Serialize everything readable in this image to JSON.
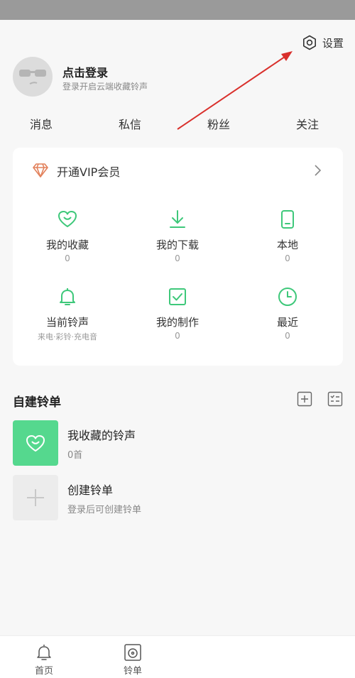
{
  "header": {
    "settings_label": "设置",
    "login_title": "点击登录",
    "login_subtitle": "登录开启云端收藏铃声"
  },
  "social": {
    "items": [
      "消息",
      "私信",
      "粉丝",
      "关注"
    ]
  },
  "vip": {
    "label": "开通VIP会员"
  },
  "grid": [
    {
      "label": "我的收藏",
      "count": "0",
      "icon": "heart-smile-icon"
    },
    {
      "label": "我的下载",
      "count": "0",
      "icon": "download-icon"
    },
    {
      "label": "本地",
      "count": "0",
      "icon": "phone-icon"
    },
    {
      "label": "当前铃声",
      "sub": "来电·彩铃·充电音",
      "icon": "bell-icon"
    },
    {
      "label": "我的制作",
      "count": "0",
      "icon": "checkbox-icon"
    },
    {
      "label": "最近",
      "count": "0",
      "icon": "clock-icon"
    }
  ],
  "playlists": {
    "title": "自建铃单",
    "items": [
      {
        "title": "我收藏的铃声",
        "subtitle": "0首"
      },
      {
        "title": "创建铃单",
        "subtitle": "登录后可创建铃单"
      }
    ]
  },
  "tabs": [
    {
      "label": "首页",
      "icon": "bell-icon"
    },
    {
      "label": "铃单",
      "icon": "disc-icon"
    }
  ],
  "colors": {
    "accent": "#3ec87a",
    "annotation_arrow": "#d9302c",
    "vip_diamond": "#e2805a"
  }
}
